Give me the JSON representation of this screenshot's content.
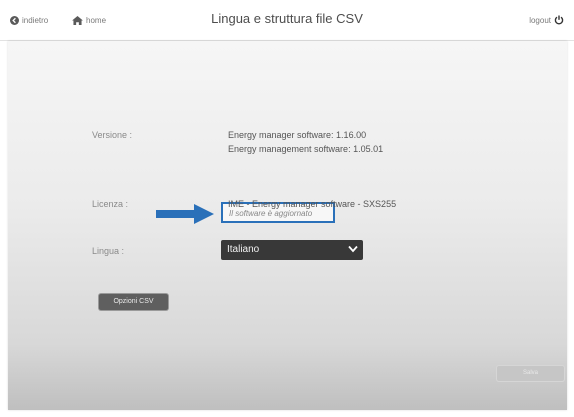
{
  "header": {
    "back_label": "indietro",
    "home_label": "home",
    "title": "Lingua e struttura file CSV",
    "logout_label": "logout"
  },
  "version": {
    "label": "Versione :",
    "manager_software": "Energy manager software: 1.16.00",
    "management_software": "Energy management software: 1.05.01",
    "status": "Il software è aggiornato"
  },
  "license": {
    "label": "Licenza :",
    "value": "IME - Energy manager software - SXS255"
  },
  "language": {
    "label": "Lingua :",
    "selected": "Italiano"
  },
  "buttons": {
    "csv_options": "Opzioni CSV",
    "save": "Salva"
  },
  "colors": {
    "accent_blue": "#2a70b9",
    "select_bg": "#383838"
  },
  "icons": [
    "back-circle-icon",
    "home-icon",
    "power-icon",
    "arrow-right-icon",
    "chevron-down-icon"
  ]
}
